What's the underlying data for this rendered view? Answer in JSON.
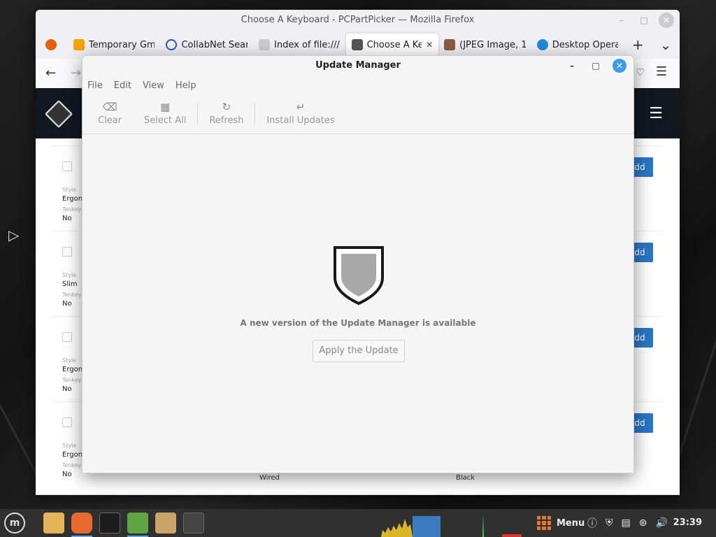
{
  "firefox": {
    "window_title": "Choose A Keyboard - PCPartPicker — Mozilla Firefox",
    "tabs": [
      {
        "label": "Temporary Gm",
        "icon": "mail-icon"
      },
      {
        "label": "CollabNet Sear",
        "icon": "search-icon"
      },
      {
        "label": "Index of file:///",
        "icon": "file-icon"
      },
      {
        "label": "Choose A Ke",
        "icon": "pcpartpicker-icon",
        "active": true
      },
      {
        "label": "(JPEG Image, 1",
        "icon": "image-icon"
      },
      {
        "label": "Desktop Opera",
        "icon": "edge-icon"
      }
    ]
  },
  "ppp": {
    "add_label": "Add",
    "rows": [
      {
        "style_label": "Style",
        "style_value": "Ergono",
        "tenkey_label": "Tenkey",
        "tenkey_value": "No"
      },
      {
        "style_label": "Style",
        "style_value": "Slim",
        "tenkey_label": "Tenkey",
        "tenkey_value": "No"
      },
      {
        "style_label": "Style",
        "style_value": "Ergono",
        "tenkey_label": "Tenkey",
        "tenkey_value": "No"
      },
      {
        "style_label": "Style",
        "style_value": "Ergono",
        "tenkey_label": "Tenkey",
        "tenkey_value": "No",
        "connection": "Wired",
        "color": "Black"
      }
    ]
  },
  "update_manager": {
    "title": "Update Manager",
    "menu": [
      "File",
      "Edit",
      "View",
      "Help"
    ],
    "toolbar": {
      "clear": "Clear",
      "select_all": "Select All",
      "refresh": "Refresh",
      "install_updates": "Install Updates"
    },
    "message": "A new version of the Update Manager is available",
    "apply_button": "Apply the Update"
  },
  "taskbar": {
    "menu_label": "Menu",
    "clock": "23:39"
  },
  "colors": {
    "accent_blue": "#3a9ee6",
    "add_button": "#2a76c6",
    "menu_orange": "#e8772e"
  }
}
